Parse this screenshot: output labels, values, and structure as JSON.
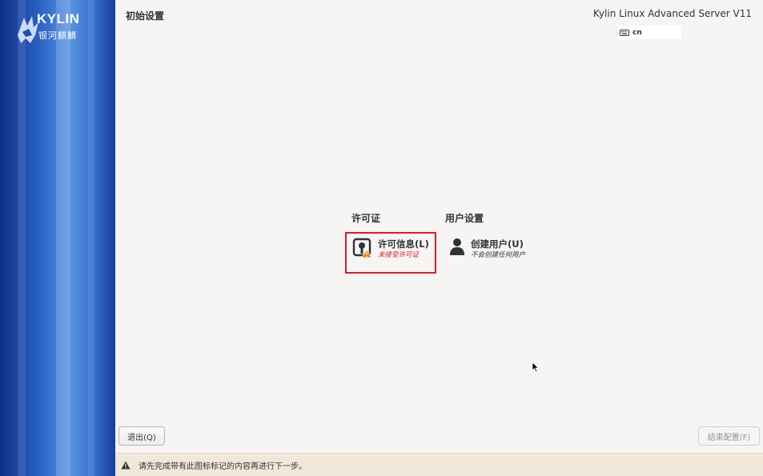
{
  "sidebar": {
    "logo_text": "KYLIN",
    "logo_sub": "银河麒麟"
  },
  "header": {
    "title": "初始设置",
    "product": "Kylin Linux Advanced Server V11",
    "keyboard_layout": "cn"
  },
  "sections": [
    {
      "title": "许可证",
      "spoke": {
        "label": "许可信息(L)",
        "status": "未接受许可证",
        "icon": "license-warning-icon"
      }
    },
    {
      "title": "用户设置",
      "spoke": {
        "label": "创建用户(U)",
        "status": "不会创建任何用户",
        "icon": "user-icon"
      }
    }
  ],
  "buttons": {
    "quit": "退出(Q)",
    "finish": "结束配置(F)"
  },
  "warning": {
    "text": "请先完成带有此图标标记的内容再进行下一步。"
  },
  "colors": {
    "warning_border": "#e01b24",
    "sidebar_blue": "#2a63c4",
    "warning_bar": "#f2e8da"
  }
}
